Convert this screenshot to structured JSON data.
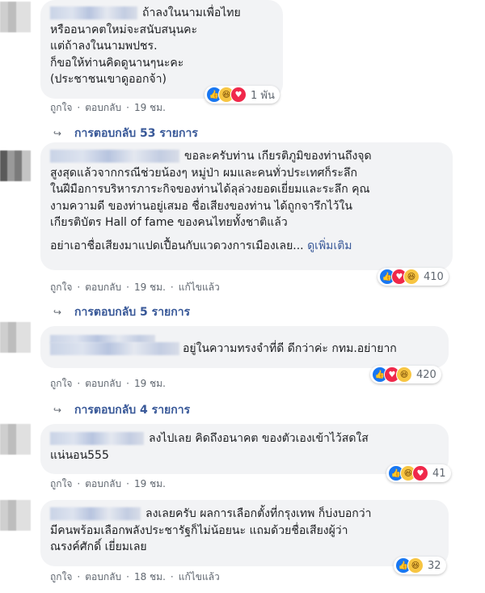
{
  "comments": [
    {
      "lines": [
        "ถ้าลงในนามเพื่อไทย",
        "หรืออนาคตใหม่จะสนับสนุนคะ",
        "แต่ถ้าลงในนามพปชร.",
        "ก็ขอให้ท่านคิดดูนานๆนะคะ",
        "(ประชาชนเขาดูออกจ้า)"
      ],
      "see_more": "",
      "actions": {
        "like": "ถูกใจ",
        "reply": "ตอบกลับ",
        "time": "19 ชม.",
        "edited": ""
      },
      "reactions": {
        "icons": [
          "like-icon",
          "haha-icon",
          "love-icon"
        ],
        "count": "1 พัน"
      },
      "replies_label": "การตอบกลับ 53 รายการ"
    },
    {
      "lines": [
        "ขอละครับท่าน เกียรติภูมิของท่านถึงจุด",
        "สูงสุดแล้วจากกรณีช่วยน้องๆ หมู่ป่า ผมและคนทั่วประเทศก็ระลึก",
        "ในฝีมือการบริหารภาระกิจของท่านได้ลุล่วงยอดเยี่ยมและระลึก คุณ",
        "งามความดี ของท่านอยู่เสมอ ชื่อเสียงของท่าน ได้ถูกจารึกไว้ใน",
        "เกียรติบัตร Hall of fame ของคนไทยทั้งชาติแล้ว",
        "",
        "อย่าเอาชื่อเสียงมาแปดเปื้อนกับแวดวงการเมืองเลย..."
      ],
      "see_more": "ดูเพิ่มเติม",
      "actions": {
        "like": "ถูกใจ",
        "reply": "ตอบกลับ",
        "time": "19 ชม.",
        "edited": "แก้ไขแล้ว"
      },
      "reactions": {
        "icons": [
          "like-icon",
          "love-icon",
          "haha-icon"
        ],
        "count": "410"
      },
      "replies_label": "การตอบกลับ 5 รายการ"
    },
    {
      "lines": [
        "อยู่ในความทรงจำที่ดี ดีกว่าค่ะ กทม.อย่ายาก"
      ],
      "see_more": "",
      "actions": {
        "like": "ถูกใจ",
        "reply": "ตอบกลับ",
        "time": "19 ชม.",
        "edited": ""
      },
      "reactions": {
        "icons": [
          "like-icon",
          "love-icon",
          "haha-icon"
        ],
        "count": "420"
      },
      "replies_label": "การตอบกลับ 4 รายการ"
    },
    {
      "lines": [
        "ลงไปเลย คิดถึงอนาคต ของตัวเองเข้าไว้สดใส",
        "แน่นอน555"
      ],
      "see_more": "",
      "actions": {
        "like": "ถูกใจ",
        "reply": "ตอบกลับ",
        "time": "19 ชม.",
        "edited": ""
      },
      "reactions": {
        "icons": [
          "like-icon",
          "haha-icon",
          "love-icon"
        ],
        "count": "41"
      },
      "replies_label": ""
    },
    {
      "lines": [
        "ลงเลยครับ ผลการเลือกตั้งที่กรุงเทพ ก็บ่งบอกว่า",
        "มีคนพร้อมเลือกพลังประชารัฐก็ไม่น้อยนะ แถมด้วยชื่อเสียงผู้ว่า",
        "ณรงค์ศักดิ์ เยี่ยมเลย"
      ],
      "see_more": "",
      "actions": {
        "like": "ถูกใจ",
        "reply": "ตอบกลับ",
        "time": "18 ชม.",
        "edited": "แก้ไขแล้ว"
      },
      "reactions": {
        "icons": [
          "like-icon",
          "haha-icon"
        ],
        "count": "32"
      },
      "replies_label": ""
    }
  ],
  "colors": {
    "bubble": "#f2f3f5",
    "link": "#385898",
    "meta": "#606770",
    "like": "#1877f2",
    "love": "#f0284a",
    "haha": "#f7c542"
  }
}
